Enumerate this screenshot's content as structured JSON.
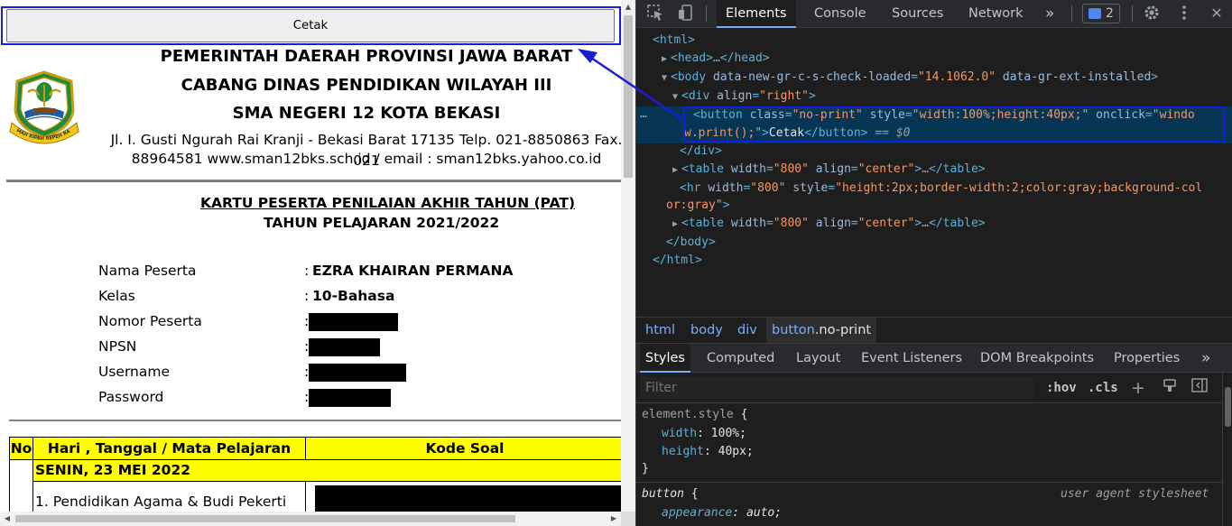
{
  "webpage": {
    "print_button_label": "Cetak",
    "header": {
      "line1": "PEMERINTAH DAERAH PROVINSI JAWA BARAT",
      "line2": "CABANG DINAS PENDIDIKAN WILAYAH III",
      "line3": "SMA NEGERI 12 KOTA BEKASI",
      "address_line1": "Jl. I. Gusti Ngurah Rai Kranji - Bekasi Barat 17135 Telp. 021-8850863 Fax. 021",
      "address_line2": "88964581 www.sman12bks.sch.id / email : sman12bks.yahoo.co.id",
      "emblem_text": "GEMAH RIPAH REPEH RAPIH"
    },
    "card_title": "KARTU PESERTA PENILAIAN AKHIR TAHUN (PAT)",
    "card_subtitle": "TAHUN PELAJARAN 2021/2022",
    "fields": [
      {
        "label": "Nama Peserta",
        "colon": ":",
        "value": "EZRA KHAIRAN PERMANA"
      },
      {
        "label": "Kelas",
        "colon": ":",
        "value": "10-Bahasa"
      },
      {
        "label": "Nomor Peserta",
        "colon": ":",
        "value": ""
      },
      {
        "label": "NPSN",
        "colon": ":",
        "value": ""
      },
      {
        "label": "Username",
        "colon": ":",
        "value": ""
      },
      {
        "label": "Password",
        "colon": ":",
        "value": ""
      }
    ],
    "table": {
      "headers": [
        "No",
        "Hari , Tanggal / Mata Pelajaran",
        "Kode Soal"
      ],
      "day_row": "SENIN, 23 MEI 2022",
      "subject_row": "1. Pendidikan Agama & Budi Pekerti"
    },
    "colors": {
      "table_header_bg": "#ffff00",
      "highlight_outline": "#1c1cd6"
    }
  },
  "devtools": {
    "toolbar": {
      "inspect_icon": "inspect-element-icon",
      "device_icon": "device-toolbar-icon",
      "tabs": [
        "Elements",
        "Console",
        "Sources",
        "Network"
      ],
      "active_tab": "Elements",
      "more_tabs_glyph": "»",
      "issues_count": "2",
      "settings_icon": "gear-icon",
      "menu_icon": "kebab-menu-icon",
      "close_glyph": "✕"
    },
    "dom_lines": [
      [
        {
          "t": "<html>",
          "c": "t-tag"
        }
      ],
      [
        {
          "t": "▶",
          "c": "tri"
        },
        {
          "t": "<head>",
          "c": "t-tag"
        },
        {
          "t": "…",
          "c": "t-dim"
        },
        {
          "t": "</head>",
          "c": "t-tag"
        }
      ],
      [
        {
          "t": "▼",
          "c": "tri"
        },
        {
          "t": "<body ",
          "c": "t-tag"
        },
        {
          "t": "data-new-gr-c-s-check-loaded",
          "c": "t-attr"
        },
        {
          "t": "=",
          "c": "t-tag"
        },
        {
          "t": "\"14.1062.0\"",
          "c": "t-val"
        },
        {
          "t": " data-gr-ext-installed",
          "c": "t-attr"
        },
        {
          "t": ">",
          "c": "t-tag"
        }
      ],
      [
        {
          "t": "▼",
          "c": "tri"
        },
        {
          "t": "<div ",
          "c": "t-tag"
        },
        {
          "t": "align",
          "c": "t-attr"
        },
        {
          "t": "=",
          "c": "t-tag"
        },
        {
          "t": "\"right\"",
          "c": "t-val"
        },
        {
          "t": ">",
          "c": "t-tag"
        }
      ],
      [
        {
          "t": "<button ",
          "c": "t-tag"
        },
        {
          "t": "class",
          "c": "t-attr"
        },
        {
          "t": "=",
          "c": "t-tag"
        },
        {
          "t": "\"no-print\"",
          "c": "t-val"
        },
        {
          "t": " style",
          "c": "t-attr"
        },
        {
          "t": "=",
          "c": "t-tag"
        },
        {
          "t": "\"width:100%;height:40px;\"",
          "c": "t-val"
        },
        {
          "t": " onclick",
          "c": "t-attr"
        },
        {
          "t": "=",
          "c": "t-tag"
        },
        {
          "t": "\"windo",
          "c": "t-val"
        }
      ],
      [
        {
          "t": "w.print();\"",
          "c": "t-val"
        },
        {
          "t": ">",
          "c": "t-tag"
        },
        {
          "t": "Cetak",
          "c": "t-txt"
        },
        {
          "t": "</button>",
          "c": "t-tag"
        },
        {
          "t": " == $0",
          "c": "t-ref"
        }
      ],
      [
        {
          "t": "</div>",
          "c": "t-tag"
        }
      ],
      [
        {
          "t": "▶",
          "c": "tri"
        },
        {
          "t": "<table ",
          "c": "t-tag"
        },
        {
          "t": "width",
          "c": "t-attr"
        },
        {
          "t": "=",
          "c": "t-tag"
        },
        {
          "t": "\"800\"",
          "c": "t-val"
        },
        {
          "t": " align",
          "c": "t-attr"
        },
        {
          "t": "=",
          "c": "t-tag"
        },
        {
          "t": "\"center\"",
          "c": "t-val"
        },
        {
          "t": ">",
          "c": "t-tag"
        },
        {
          "t": "…",
          "c": "t-dim"
        },
        {
          "t": "</table>",
          "c": "t-tag"
        }
      ],
      [
        {
          "t": "<hr ",
          "c": "t-tag"
        },
        {
          "t": "width",
          "c": "t-attr"
        },
        {
          "t": "=",
          "c": "t-tag"
        },
        {
          "t": "\"800\"",
          "c": "t-val"
        },
        {
          "t": " style",
          "c": "t-attr"
        },
        {
          "t": "=",
          "c": "t-tag"
        },
        {
          "t": "\"height:2px;border-width:2;color:gray;background-col",
          "c": "t-val"
        }
      ],
      [
        {
          "t": "or:gray\"",
          "c": "t-val"
        },
        {
          "t": ">",
          "c": "t-tag"
        }
      ],
      [
        {
          "t": "▶",
          "c": "tri"
        },
        {
          "t": "<table ",
          "c": "t-tag"
        },
        {
          "t": "width",
          "c": "t-attr"
        },
        {
          "t": "=",
          "c": "t-tag"
        },
        {
          "t": "\"800\"",
          "c": "t-val"
        },
        {
          "t": " align",
          "c": "t-attr"
        },
        {
          "t": "=",
          "c": "t-tag"
        },
        {
          "t": "\"center\"",
          "c": "t-val"
        },
        {
          "t": ">",
          "c": "t-tag"
        },
        {
          "t": "…",
          "c": "t-dim"
        },
        {
          "t": "</table>",
          "c": "t-tag"
        }
      ],
      [
        {
          "t": "</body>",
          "c": "t-tag"
        }
      ],
      [
        {
          "t": "</html>",
          "c": "t-tag"
        }
      ]
    ],
    "selected_dots": "…",
    "breadcrumb": {
      "items": [
        "html",
        "body",
        "div"
      ],
      "active_tag": "button",
      "active_class": ".no-print"
    },
    "styles": {
      "tabs": [
        "Styles",
        "Computed",
        "Layout",
        "Event Listeners",
        "DOM Breakpoints",
        "Properties"
      ],
      "active_tab": "Styles",
      "more_glyph": "»",
      "filter_placeholder": "Filter",
      "hov": ":hov",
      "cls": ".cls",
      "add_glyph": "+",
      "element_style_selector": "element.style",
      "open_brace": " {",
      "close_brace": "}",
      "element_props": [
        {
          "name": "width",
          "value": "100%;"
        },
        {
          "name": "height",
          "value": "40px;"
        }
      ],
      "button_selector": "button",
      "ua_label": "user agent stylesheet",
      "button_props": [
        {
          "name": "appearance",
          "value": "auto;"
        }
      ]
    }
  }
}
